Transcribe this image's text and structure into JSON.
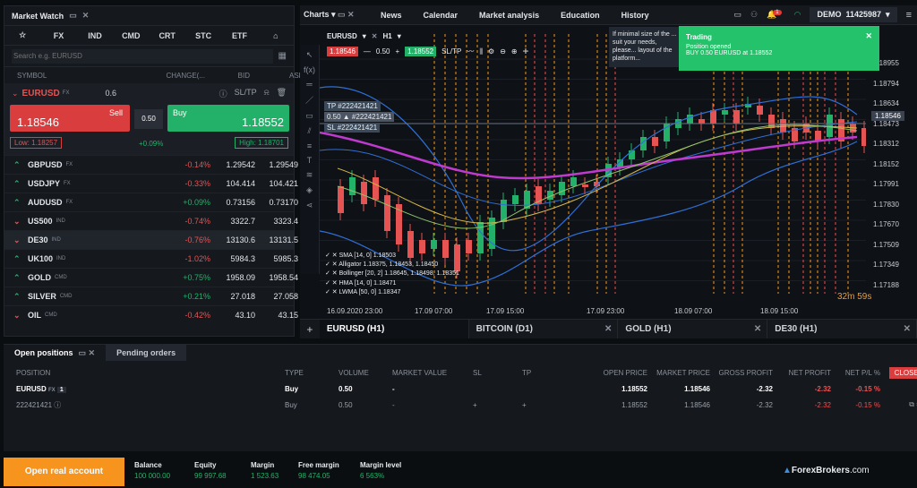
{
  "market_watch": {
    "title": "Market Watch",
    "tabs": [
      "☆",
      "FX",
      "IND",
      "CMD",
      "CRT",
      "STC",
      "ETF",
      "⌂"
    ],
    "search_placeholder": "Search e.g. EURUSD",
    "headers": [
      "SYMBOL",
      "CHANGE(...",
      "BID",
      "ASK"
    ],
    "selected": {
      "symbol": "EURUSD",
      "tag": "FX",
      "spread": "0.6",
      "sltp": "SL/TP",
      "sell_label": "Sell",
      "sell_price": "1.18546",
      "buy_label": "Buy",
      "buy_price": "1.18552",
      "volume": "0.50",
      "low": "Low: 1.18257",
      "high": "High: 1.18701",
      "change": "+0.09%"
    },
    "rows": [
      {
        "symbol": "GBPUSD",
        "tag": "FX",
        "dir": "up",
        "change": "-0.14%",
        "bid": "1.29542",
        "ask": "1.29549"
      },
      {
        "symbol": "USDJPY",
        "tag": "FX",
        "dir": "up",
        "change": "-0.33%",
        "bid": "104.414",
        "ask": "104.421"
      },
      {
        "symbol": "AUDUSD",
        "tag": "FX",
        "dir": "up",
        "change": "+0.09%",
        "bid": "0.73156",
        "ask": "0.73170"
      },
      {
        "symbol": "US500",
        "tag": "IND",
        "dir": "down",
        "change": "-0.74%",
        "bid": "3322.7",
        "ask": "3323.4"
      },
      {
        "symbol": "DE30",
        "tag": "IND",
        "dir": "down",
        "change": "-0.76%",
        "bid": "13130.6",
        "ask": "13131.5"
      },
      {
        "symbol": "UK100",
        "tag": "IND",
        "dir": "up",
        "change": "-1.02%",
        "bid": "5984.3",
        "ask": "5985.3"
      },
      {
        "symbol": "GOLD",
        "tag": "CMD",
        "dir": "up",
        "change": "+0.75%",
        "bid": "1958.09",
        "ask": "1958.54"
      },
      {
        "symbol": "SILVER",
        "tag": "CMD",
        "dir": "up",
        "change": "+0.21%",
        "bid": "27.018",
        "ask": "27.058"
      },
      {
        "symbol": "OIL",
        "tag": "CMD",
        "dir": "down",
        "change": "-0.42%",
        "bid": "43.10",
        "ask": "43.15"
      }
    ]
  },
  "chart": {
    "menu": "Charts",
    "nav": [
      "News",
      "Calendar",
      "Market analysis",
      "Education",
      "History"
    ],
    "account_type": "DEMO",
    "account_id": "11425987",
    "notif_count": "1",
    "symbol": "EURUSD",
    "tf": "H1",
    "bid_box": "1.18546",
    "vol": "0.50",
    "ask_box": "1.18552",
    "sltp": "SL/TP",
    "orders": [
      {
        "label": "TP  #222421421"
      },
      {
        "label": "0.50 ▲ #222421421"
      },
      {
        "label": "SL  #222421421"
      }
    ],
    "indicators": [
      "SMA [14, 0] 1.18503",
      "Alligator 1.18375, 1.18453, 1.18450",
      "Bollinger [20, 2] 1.18645, 1.18498, 1.18351",
      "HMA [14, 0] 1.18471",
      "LWMA [50, 0] 1.18347"
    ],
    "price_axis": [
      "1.18955",
      "1.18794",
      "1.18634",
      "1.18473",
      "1.18312",
      "1.18152",
      "1.17991",
      "1.17830",
      "1.17670",
      "1.17509",
      "1.17349",
      "1.17188"
    ],
    "current_price": "1.18546",
    "countdown": "32m 59s",
    "time_axis": [
      "16.09.2020 23:00",
      "17.09 07:00",
      "17.09 15:00",
      "17.09 23:00",
      "18.09 07:00",
      "18.09 15:00"
    ],
    "tabs": [
      {
        "name": "EURUSD (H1)",
        "active": true
      },
      {
        "name": "BITCOIN (D1)"
      },
      {
        "name": "GOLD (H1)"
      },
      {
        "name": "DE30 (H1)"
      }
    ],
    "tip_text": "If minimal size of the ... suit your needs, please... layout of the platform..."
  },
  "toast": {
    "title": "Trading",
    "line1": "Position opened",
    "line2": "BUY 0.50 EURUSD at 1.18552"
  },
  "positions": {
    "tab_open": "Open positions",
    "tab_pending": "Pending orders",
    "headers": [
      "POSITION",
      "TYPE",
      "VOLUME",
      "MARKET VALUE",
      "SL",
      "TP",
      "OPEN PRICE",
      "MARKET PRICE",
      "GROSS PROFIT",
      "NET PROFIT",
      "NET P/L %"
    ],
    "close_label": "CLOSE ▾",
    "row": {
      "symbol": "EURUSD",
      "tag": "FX",
      "count": "1",
      "type": "Buy",
      "volume": "0.50",
      "market_value": "-",
      "open_price": "1.18552",
      "market_price": "1.18546",
      "gross": "-2.32",
      "net": "-2.32",
      "netpct": "-0.15 %"
    },
    "sub": {
      "id": "222421421",
      "type": "Buy",
      "volume": "0.50",
      "market_value": "-",
      "sl": "+",
      "tp": "+",
      "open_price": "1.18552",
      "market_price": "1.18546",
      "gross": "-2.32",
      "net": "-2.32",
      "netpct": "-0.15 %"
    }
  },
  "bottom": {
    "open_account": "Open real account",
    "stats": [
      {
        "label": "Balance",
        "value": "100 000.00"
      },
      {
        "label": "Equity",
        "value": "99 997.68"
      },
      {
        "label": "Margin",
        "value": "1 523.63"
      },
      {
        "label": "Free margin",
        "value": "98 474.05"
      },
      {
        "label": "Margin level",
        "value": "6 563%"
      }
    ],
    "brand": "ForexBrokers",
    "brand_suffix": ".com"
  },
  "colors": {
    "up": "#23b169",
    "down": "#e55353",
    "accent": "#f7941d"
  }
}
